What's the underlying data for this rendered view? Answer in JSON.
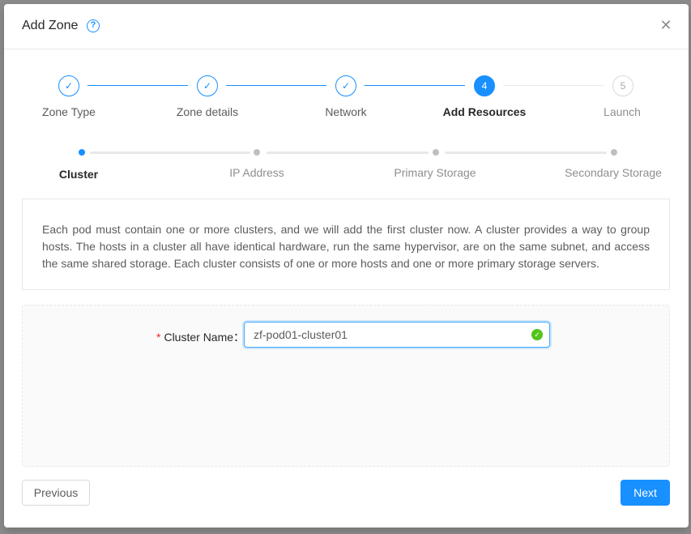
{
  "modal": {
    "title": "Add Zone",
    "help_icon": "question-circle-icon",
    "close_icon": "close-icon"
  },
  "steps": [
    {
      "label": "Zone Type",
      "status": "done",
      "icon": "check-icon"
    },
    {
      "label": "Zone details",
      "status": "done",
      "icon": "check-icon"
    },
    {
      "label": "Network",
      "status": "done",
      "icon": "check-icon"
    },
    {
      "label": "Add Resources",
      "status": "active",
      "number": "4"
    },
    {
      "label": "Launch",
      "status": "wait",
      "number": "5"
    }
  ],
  "sub_steps": [
    {
      "label": "Cluster",
      "status": "active"
    },
    {
      "label": "IP Address",
      "status": "wait"
    },
    {
      "label": "Primary Storage",
      "status": "wait"
    },
    {
      "label": "Secondary Storage",
      "status": "wait"
    }
  ],
  "description": "Each pod must contain one or more clusters, and we will add the first cluster now. A cluster provides a way to group hosts. The hosts in a cluster all have identical hardware, run the same hypervisor, are on the same subnet, and access the same shared storage. Each cluster consists of one or more hosts and one or more primary storage servers.",
  "form": {
    "cluster_name_label": "Cluster Name",
    "required_mark": "*",
    "cluster_name_value": "zf-pod01-cluster01",
    "validation_icon": "check-circle-icon"
  },
  "buttons": {
    "previous": "Previous",
    "next": "Next"
  },
  "colors": {
    "primary": "#1890ff",
    "success": "#52c41a",
    "required": "#f5222d"
  }
}
